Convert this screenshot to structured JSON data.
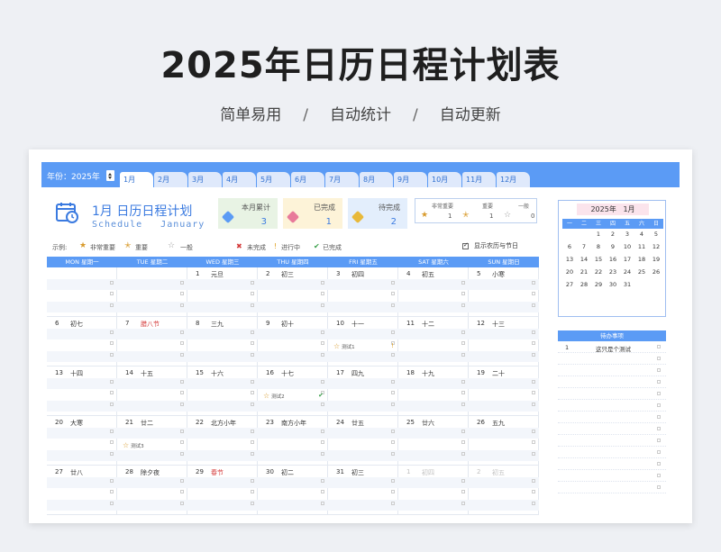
{
  "page": {
    "headline": "2025年日历日程计划表",
    "tags": [
      "简单易用",
      "自动统计",
      "自动更新"
    ],
    "separator": "/"
  },
  "topbar": {
    "year_label": "年份：2025年",
    "months": [
      "1月",
      "2月",
      "3月",
      "4月",
      "5月",
      "6月",
      "7月",
      "8月",
      "9月",
      "10月",
      "11月",
      "12月"
    ],
    "active_index": 0
  },
  "title": {
    "cn": "1月 日历日程计划",
    "en": "Schedule",
    "en_month": "January"
  },
  "stats": [
    {
      "label": "本月累计",
      "value": "3",
      "color": "#5b9bf5",
      "bg": "#e8f3e4"
    },
    {
      "label": "已完成",
      "value": "1",
      "color": "#e87a9a",
      "bg": "#fdf3d8"
    },
    {
      "label": "待完成",
      "value": "2",
      "color": "#e8b93a",
      "bg": "#e3eefc"
    }
  ],
  "priority": [
    {
      "label": "非常重要",
      "value": "1"
    },
    {
      "label": "重要",
      "value": "1"
    },
    {
      "label": "一般",
      "value": "0"
    }
  ],
  "legend": {
    "prefix": "示例:",
    "items": [
      "非常重要",
      "重要",
      "一般",
      "未完成",
      "进行中",
      "已完成"
    ],
    "lunar_toggle": "显示农历与节日"
  },
  "weekdays": [
    "MON 星期一",
    "TUE 星期二",
    "WED 星期三",
    "THU 星期四",
    "FRI 星期五",
    "SAT 星期六",
    "SUN 星期日"
  ],
  "calendar": [
    [
      null,
      null,
      {
        "d": "1",
        "l": "元旦"
      },
      {
        "d": "2",
        "l": "初三"
      },
      {
        "d": "3",
        "l": "初四"
      },
      {
        "d": "4",
        "l": "初五"
      },
      {
        "d": "5",
        "l": "小寒"
      }
    ],
    [
      {
        "d": "6",
        "l": "初七"
      },
      {
        "d": "7",
        "l": "腊八节",
        "red": true
      },
      {
        "d": "8",
        "l": "三九"
      },
      {
        "d": "9",
        "l": "初十"
      },
      {
        "d": "10",
        "l": "十一",
        "event": "测试1",
        "mark": "!"
      },
      {
        "d": "11",
        "l": "十二"
      },
      {
        "d": "12",
        "l": "十三"
      }
    ],
    [
      {
        "d": "13",
        "l": "十四"
      },
      {
        "d": "14",
        "l": "十五"
      },
      {
        "d": "15",
        "l": "十六"
      },
      {
        "d": "16",
        "l": "十七",
        "event": "测试2",
        "mark": "✔"
      },
      {
        "d": "17",
        "l": "四九"
      },
      {
        "d": "18",
        "l": "十九"
      },
      {
        "d": "19",
        "l": "二十"
      }
    ],
    [
      {
        "d": "20",
        "l": "大寒"
      },
      {
        "d": "21",
        "l": "廿二",
        "event": "测试3"
      },
      {
        "d": "22",
        "l": "北方小年"
      },
      {
        "d": "23",
        "l": "南方小年"
      },
      {
        "d": "24",
        "l": "廿五"
      },
      {
        "d": "25",
        "l": "廿六"
      },
      {
        "d": "26",
        "l": "五九"
      }
    ],
    [
      {
        "d": "27",
        "l": "廿八"
      },
      {
        "d": "28",
        "l": "除夕夜"
      },
      {
        "d": "29",
        "l": "春节",
        "red": true
      },
      {
        "d": "30",
        "l": "初二"
      },
      {
        "d": "31",
        "l": "初三"
      },
      {
        "d": "1",
        "l": "初四",
        "grey": true
      },
      {
        "d": "2",
        "l": "初五",
        "grey": true
      }
    ]
  ],
  "mini": {
    "year": "2025年",
    "month": "1月",
    "weekdays": [
      "一",
      "二",
      "三",
      "四",
      "五",
      "六",
      "日"
    ],
    "weeks": [
      [
        "",
        "",
        "1",
        "2",
        "3",
        "4",
        "5"
      ],
      [
        "6",
        "7",
        "8",
        "9",
        "10",
        "11",
        "12"
      ],
      [
        "13",
        "14",
        "15",
        "16",
        "17",
        "18",
        "19"
      ],
      [
        "20",
        "21",
        "22",
        "23",
        "24",
        "25",
        "26"
      ],
      [
        "27",
        "28",
        "29",
        "30",
        "31",
        "",
        ""
      ]
    ]
  },
  "todo": {
    "header": "待办事项",
    "items": [
      {
        "n": "1",
        "t": "这只是个测试"
      }
    ]
  }
}
